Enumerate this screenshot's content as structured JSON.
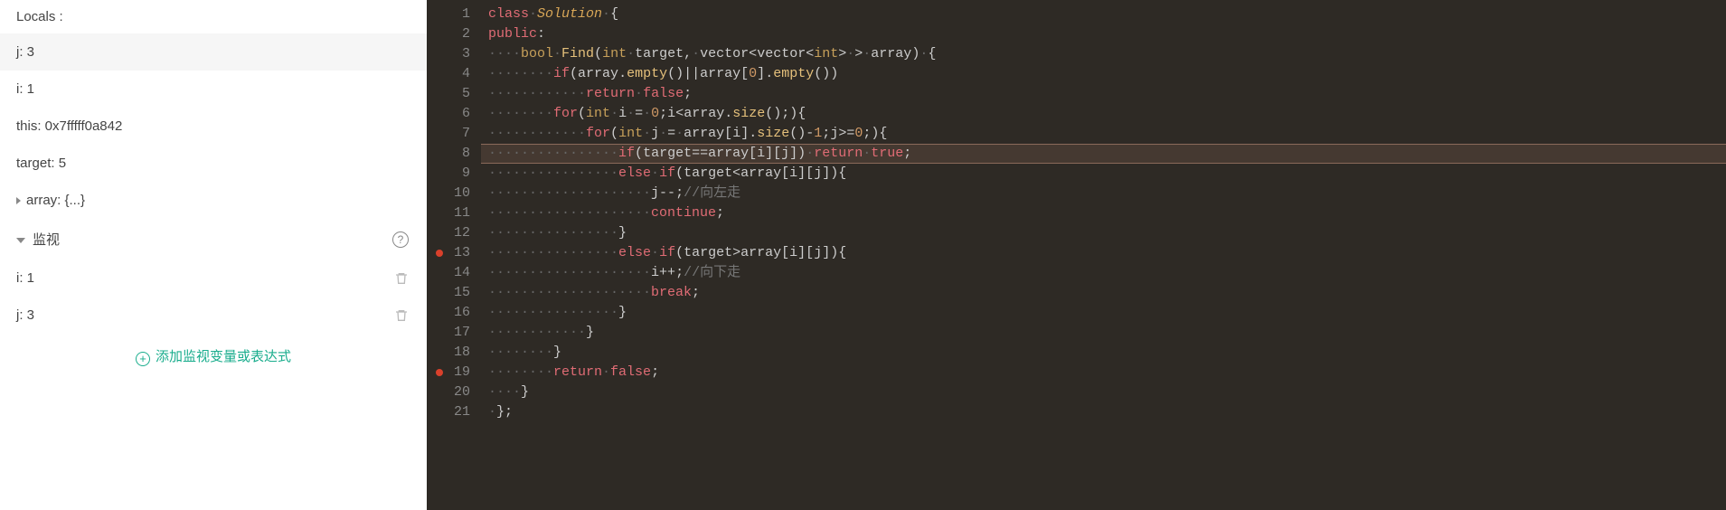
{
  "sidebar": {
    "locals_label": "Locals :",
    "locals": [
      {
        "label": "j: 3"
      },
      {
        "label": "i: 1"
      },
      {
        "label": "this: 0x7fffff0a842"
      },
      {
        "label": "target: 5"
      },
      {
        "label": "array: {...}",
        "expandable": true
      }
    ],
    "watch_label": "监视",
    "watches": [
      {
        "label": "i: 1"
      },
      {
        "label": "j: 3"
      }
    ],
    "add_watch_label": "添加监视变量或表达式"
  },
  "editor": {
    "highlighted_line": 8,
    "breakpoints": [
      13,
      19
    ],
    "lines": [
      {
        "n": 1,
        "tokens": [
          [
            "kw",
            "class"
          ],
          [
            "dot",
            "·"
          ],
          [
            "cls",
            "Solution"
          ],
          [
            "dot",
            "·"
          ],
          [
            "pn",
            "{"
          ]
        ]
      },
      {
        "n": 2,
        "tokens": [
          [
            "kw",
            "public"
          ],
          [
            "pn",
            ":"
          ]
        ]
      },
      {
        "n": 3,
        "tokens": [
          [
            "dot",
            "····"
          ],
          [
            "ty",
            "bool"
          ],
          [
            "dot",
            "·"
          ],
          [
            "fn",
            "Find"
          ],
          [
            "pn",
            "("
          ],
          [
            "ty",
            "int"
          ],
          [
            "dot",
            "·"
          ],
          [
            "op",
            "target"
          ],
          [
            "pn",
            ","
          ],
          [
            "dot",
            "·"
          ],
          [
            "op",
            "vector"
          ],
          [
            "pn",
            "<"
          ],
          [
            "op",
            "vector"
          ],
          [
            "pn",
            "<"
          ],
          [
            "ty",
            "int"
          ],
          [
            "pn",
            ">"
          ],
          [
            "dot",
            "·"
          ],
          [
            "pn",
            ">"
          ],
          [
            "dot",
            "·"
          ],
          [
            "op",
            "array"
          ],
          [
            "pn",
            ")"
          ],
          [
            "dot",
            "·"
          ],
          [
            "pn",
            "{"
          ]
        ]
      },
      {
        "n": 4,
        "tokens": [
          [
            "dot",
            "········"
          ],
          [
            "kw",
            "if"
          ],
          [
            "pn",
            "("
          ],
          [
            "op",
            "array"
          ],
          [
            "pn",
            "."
          ],
          [
            "fn",
            "empty"
          ],
          [
            "pn",
            "()"
          ],
          [
            "op",
            "||"
          ],
          [
            "op",
            "array"
          ],
          [
            "pn",
            "["
          ],
          [
            "num",
            "0"
          ],
          [
            "pn",
            "]"
          ],
          [
            "pn",
            "."
          ],
          [
            "fn",
            "empty"
          ],
          [
            "pn",
            "())"
          ]
        ]
      },
      {
        "n": 5,
        "tokens": [
          [
            "dot",
            "············"
          ],
          [
            "kw",
            "return"
          ],
          [
            "dot",
            "·"
          ],
          [
            "kw",
            "false"
          ],
          [
            "pn",
            ";"
          ]
        ]
      },
      {
        "n": 6,
        "tokens": [
          [
            "dot",
            "········"
          ],
          [
            "kw",
            "for"
          ],
          [
            "pn",
            "("
          ],
          [
            "ty",
            "int"
          ],
          [
            "dot",
            "·"
          ],
          [
            "op",
            "i"
          ],
          [
            "dot",
            "·"
          ],
          [
            "op",
            "="
          ],
          [
            "dot",
            "·"
          ],
          [
            "num",
            "0"
          ],
          [
            "pn",
            ";"
          ],
          [
            "op",
            "i"
          ],
          [
            "pn",
            "<"
          ],
          [
            "op",
            "array"
          ],
          [
            "pn",
            "."
          ],
          [
            "fn",
            "size"
          ],
          [
            "pn",
            "();){"
          ]
        ]
      },
      {
        "n": 7,
        "tokens": [
          [
            "dot",
            "············"
          ],
          [
            "kw",
            "for"
          ],
          [
            "pn",
            "("
          ],
          [
            "ty",
            "int"
          ],
          [
            "dot",
            "·"
          ],
          [
            "op",
            "j"
          ],
          [
            "dot",
            "·"
          ],
          [
            "op",
            "="
          ],
          [
            "dot",
            "·"
          ],
          [
            "op",
            "array"
          ],
          [
            "pn",
            "["
          ],
          [
            "op",
            "i"
          ],
          [
            "pn",
            "]"
          ],
          [
            "pn",
            "."
          ],
          [
            "fn",
            "size"
          ],
          [
            "pn",
            "()"
          ],
          [
            "op",
            "-"
          ],
          [
            "num",
            "1"
          ],
          [
            "pn",
            ";"
          ],
          [
            "op",
            "j"
          ],
          [
            "op",
            ">="
          ],
          [
            "num",
            "0"
          ],
          [
            "pn",
            ";){"
          ]
        ]
      },
      {
        "n": 8,
        "tokens": [
          [
            "dot",
            "················"
          ],
          [
            "kw",
            "if"
          ],
          [
            "pn",
            "("
          ],
          [
            "op",
            "target"
          ],
          [
            "op",
            "=="
          ],
          [
            "op",
            "array"
          ],
          [
            "pn",
            "["
          ],
          [
            "op",
            "i"
          ],
          [
            "pn",
            "]["
          ],
          [
            "op",
            "j"
          ],
          [
            "pn",
            "])"
          ],
          [
            "dot",
            "·"
          ],
          [
            "kw",
            "return"
          ],
          [
            "dot",
            "·"
          ],
          [
            "kw",
            "true"
          ],
          [
            "pn",
            ";"
          ]
        ]
      },
      {
        "n": 9,
        "tokens": [
          [
            "dot",
            "················"
          ],
          [
            "kw",
            "else"
          ],
          [
            "dot",
            "·"
          ],
          [
            "kw",
            "if"
          ],
          [
            "pn",
            "("
          ],
          [
            "op",
            "target"
          ],
          [
            "pn",
            "<"
          ],
          [
            "op",
            "array"
          ],
          [
            "pn",
            "["
          ],
          [
            "op",
            "i"
          ],
          [
            "pn",
            "]["
          ],
          [
            "op",
            "j"
          ],
          [
            "pn",
            "]){"
          ]
        ]
      },
      {
        "n": 10,
        "tokens": [
          [
            "dot",
            "····················"
          ],
          [
            "op",
            "j"
          ],
          [
            "op",
            "--"
          ],
          [
            "pn",
            ";"
          ],
          [
            "cm",
            "//向左走"
          ]
        ]
      },
      {
        "n": 11,
        "tokens": [
          [
            "dot",
            "····················"
          ],
          [
            "kw",
            "continue"
          ],
          [
            "pn",
            ";"
          ]
        ]
      },
      {
        "n": 12,
        "tokens": [
          [
            "dot",
            "················"
          ],
          [
            "pn",
            "}"
          ]
        ]
      },
      {
        "n": 13,
        "tokens": [
          [
            "dot",
            "················"
          ],
          [
            "kw",
            "else"
          ],
          [
            "dot",
            "·"
          ],
          [
            "kw",
            "if"
          ],
          [
            "pn",
            "("
          ],
          [
            "op",
            "target"
          ],
          [
            "pn",
            ">"
          ],
          [
            "op",
            "array"
          ],
          [
            "pn",
            "["
          ],
          [
            "op",
            "i"
          ],
          [
            "pn",
            "]["
          ],
          [
            "op",
            "j"
          ],
          [
            "pn",
            "]){"
          ]
        ]
      },
      {
        "n": 14,
        "tokens": [
          [
            "dot",
            "····················"
          ],
          [
            "op",
            "i"
          ],
          [
            "op",
            "++"
          ],
          [
            "pn",
            ";"
          ],
          [
            "cm",
            "//向下走"
          ]
        ]
      },
      {
        "n": 15,
        "tokens": [
          [
            "dot",
            "····················"
          ],
          [
            "kw",
            "break"
          ],
          [
            "pn",
            ";"
          ]
        ]
      },
      {
        "n": 16,
        "tokens": [
          [
            "dot",
            "················"
          ],
          [
            "pn",
            "}"
          ]
        ]
      },
      {
        "n": 17,
        "tokens": [
          [
            "dot",
            "············"
          ],
          [
            "pn",
            "}"
          ]
        ]
      },
      {
        "n": 18,
        "tokens": [
          [
            "dot",
            "········"
          ],
          [
            "pn",
            "}"
          ]
        ]
      },
      {
        "n": 19,
        "tokens": [
          [
            "dot",
            "········"
          ],
          [
            "kw",
            "return"
          ],
          [
            "dot",
            "·"
          ],
          [
            "kw",
            "false"
          ],
          [
            "pn",
            ";"
          ]
        ]
      },
      {
        "n": 20,
        "tokens": [
          [
            "dot",
            "····"
          ],
          [
            "pn",
            "}"
          ]
        ]
      },
      {
        "n": 21,
        "tokens": [
          [
            "dot",
            "·"
          ],
          [
            "pn",
            "};"
          ]
        ]
      }
    ]
  }
}
